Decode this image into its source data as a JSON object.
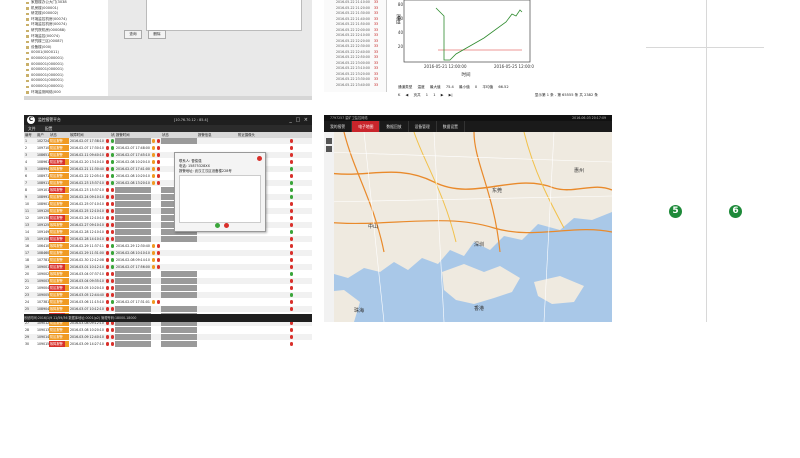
{
  "device_tree": {
    "items": [
      "家庭楼办公大门(3038",
      "机房楼(000001)",
      "研发楼(000002)",
      "环境监控机房(00074)",
      "环境监控机房(00074)",
      "研究院机房(000088)",
      "环境监控(00074)",
      "研究楼三区(00087)",
      "设备楼(000)",
      "00001(000011)",
      "0000001(000001)",
      "0000001(000001)",
      "0000001(000001)",
      "0000001(000001)",
      "0000001(000001)",
      "0000001(000001)",
      "环境监测网络(000"
    ],
    "buttons": [
      "查询",
      "删除"
    ]
  },
  "history_table": {
    "rows": [
      {
        "n": "",
        "t": "2016-05-22 21:10:00",
        "v": "33"
      },
      {
        "n": "",
        "t": "2016-05-22 21:20:00",
        "v": "33"
      },
      {
        "n": "",
        "t": "2016-05-22 21:30:00",
        "v": "33"
      },
      {
        "n": "",
        "t": "2016-05-22 21:40:00",
        "v": "33"
      },
      {
        "n": "",
        "t": "2016-05-22 21:50:00",
        "v": "33"
      },
      {
        "n": "",
        "t": "2016-05-22 22:00:00",
        "v": "33"
      },
      {
        "n": "",
        "t": "2016-05-22 22:10:00",
        "v": "33"
      },
      {
        "n": "",
        "t": "2016-05-22 22:20:00",
        "v": "33"
      },
      {
        "n": "",
        "t": "2016-05-22 22:30:00",
        "v": "33"
      },
      {
        "n": "",
        "t": "2016-05-22 22:40:00",
        "v": "33"
      },
      {
        "n": "",
        "t": "2016-05-22 22:50:00",
        "v": "33"
      },
      {
        "n": "",
        "t": "2016-05-22 23:00:00",
        "v": "33"
      },
      {
        "n": "",
        "t": "2016-05-22 23:10:00",
        "v": "33"
      },
      {
        "n": "",
        "t": "2016-05-22 23:20:00",
        "v": "33"
      },
      {
        "n": "",
        "t": "2016-05-22 23:30:00",
        "v": "33"
      },
      {
        "n": "",
        "t": "2016-05-22 23:40:00",
        "v": "33"
      }
    ]
  },
  "history_chart": {
    "ylabel": "温度",
    "xlabel": "时间",
    "ticks_x": [
      "2016-05-21 12:00:00",
      "2016-05-25 12:00:00"
    ],
    "ticks_y": [
      "80",
      "60",
      "40",
      "20"
    ],
    "line_color": "#2e8b2e",
    "limit_color": "#d9302b"
  },
  "history_stats": {
    "type_label": "通道类型",
    "type_value": "温度",
    "max_label": "最大值",
    "max_value": "75.4",
    "min_label": "最小值",
    "min_value": "0",
    "avg_label": "平均值",
    "avg_value": "66.52"
  },
  "history_pager": {
    "first": "K",
    "prev": "◀",
    "page_label": "页共",
    "page_current": "1",
    "page_total": "1",
    "next": "▶",
    "last": "▶|",
    "summary": "显示第 1 条 - 第 65555 条 共 2382 条"
  },
  "alarm_platform": {
    "title": "监控报警平台",
    "header_info": "[10.76.70.12 : 85.4]",
    "window_buttons": "_ □ ×",
    "menu": [
      "文件",
      "配置"
    ],
    "columns": [
      "编号",
      "用户",
      "状态",
      "",
      "故障时间",
      "",
      "状态",
      "报警时间",
      "",
      "",
      "状态",
      "报警信息",
      "附近摄像头",
      ""
    ],
    "rows": [
      {
        "id": "1",
        "user": "1027242",
        "state": "防区报警",
        "st": "orange",
        "time": "2016-02-07 17:38:10",
        "a": "red",
        "b": "green",
        "t2": "",
        "c": "red",
        "d": "red"
      },
      {
        "id": "2",
        "user": "1097100",
        "state": "防区报警",
        "st": "orange",
        "time": "2016-02-07 17:30:10",
        "a": "red",
        "b": "green",
        "t2": "2016-02-07 17:48:00",
        "c": "red",
        "d": "red"
      },
      {
        "id": "3",
        "user": "108651",
        "state": "防区报警",
        "st": "orange",
        "time": "2016-02-11 09:40:10",
        "a": "red",
        "b": "green",
        "t2": "2016-02-07 17:45:10",
        "c": "red",
        "d": "red"
      },
      {
        "id": "4",
        "user": "108961",
        "state": "防区报警",
        "st": "red",
        "time": "2016-02-20 13:10:10",
        "a": "red",
        "b": "green",
        "t2": "2016-02-08 10:20:10",
        "c": "red",
        "d": "red"
      },
      {
        "id": "5",
        "user": "1089944",
        "state": "故障报警",
        "st": "orange",
        "time": "2016-02-21 11:30:40",
        "a": "red",
        "b": "green",
        "t2": "2016-02-07 17:41:00",
        "c": "red",
        "d": "green"
      },
      {
        "id": "6",
        "user": "108971",
        "state": "防区报警",
        "st": "orange",
        "time": "2016-02-22 12:05:10",
        "a": "red",
        "b": "green",
        "t2": "2016-02-08 10:20:10",
        "c": "red",
        "d": "red"
      },
      {
        "id": "7",
        "user": "108911",
        "state": "防区报警",
        "st": "orange",
        "time": "2016-02-23 15:37:10",
        "a": "red",
        "b": "green",
        "t2": "2016-02-08 13:20:10",
        "c": "red",
        "d": "green"
      },
      {
        "id": "8",
        "user": "109101",
        "state": "故障报警",
        "st": "red",
        "time": "2016-02-23 15:37:10",
        "a": "red",
        "b": "red",
        "t2": "",
        "c": "",
        "d": "green"
      },
      {
        "id": "9",
        "user": "108991",
        "state": "防区报警",
        "st": "orange",
        "time": "2016-02-24 09:10:10",
        "a": "red",
        "b": "red",
        "t2": "",
        "c": "",
        "d": "green"
      },
      {
        "id": "10",
        "user": "108901",
        "state": "防区报警",
        "st": "orange",
        "time": "2016-02-25 07:10:10",
        "a": "red",
        "b": "red",
        "t2": "",
        "c": "",
        "d": "red"
      },
      {
        "id": "11",
        "user": "109120",
        "state": "防区报警",
        "st": "orange",
        "time": "2016-02-25 12:10:10",
        "a": "red",
        "b": "red",
        "t2": "",
        "c": "",
        "d": "red"
      },
      {
        "id": "12",
        "user": "109130",
        "state": "防区报警",
        "st": "red",
        "time": "2016-02-26 12:10:10",
        "a": "red",
        "b": "red",
        "t2": "",
        "c": "",
        "d": "red"
      },
      {
        "id": "13",
        "user": "109125",
        "state": "故障报警",
        "st": "orange",
        "time": "2016-02-27 09:10:10",
        "a": "red",
        "b": "red",
        "t2": "",
        "c": "",
        "d": "red"
      },
      {
        "id": "14",
        "user": "109149",
        "state": "防区报警",
        "st": "orange",
        "time": "2016-02-28 12:10:10",
        "a": "red",
        "b": "red",
        "t2": "",
        "c": "",
        "d": "green"
      },
      {
        "id": "15",
        "user": "109150",
        "state": "防区报警",
        "st": "red",
        "time": "2016-02-28 14:10:10",
        "a": "red",
        "b": "red",
        "t2": "",
        "c": "",
        "d": "red"
      },
      {
        "id": "16",
        "user": "106410",
        "state": "故障报警",
        "st": "orange",
        "time": "2016-02-29 11:37:11",
        "a": "red",
        "b": "green",
        "t2": "2016-02-29 12:30:40",
        "c": "red",
        "d": "red"
      },
      {
        "id": "17",
        "user": "108460",
        "state": "防区报警",
        "st": "orange",
        "time": "2016-02-29 11:31:00",
        "a": "red",
        "b": "green",
        "t2": "2016-02-08 10:10:10",
        "c": "red",
        "d": "red"
      },
      {
        "id": "18",
        "user": "107781",
        "state": "防区报警",
        "st": "orange",
        "time": "2016-02-30 12:12:08",
        "a": "red",
        "b": "green",
        "t2": "2016-02-08 09:14:10",
        "c": "red",
        "d": "red"
      },
      {
        "id": "19",
        "user": "109001",
        "state": "防区报警",
        "st": "red",
        "time": "2016-03-01 10:12:10",
        "a": "red",
        "b": "green",
        "t2": "2016-02-07 17:56:00",
        "c": "red",
        "d": "red"
      },
      {
        "id": "20",
        "user": "109002",
        "state": "故障报警",
        "st": "orange",
        "time": "2016-03-04 07:37:10",
        "a": "red",
        "b": "red",
        "t2": "",
        "c": "",
        "d": "green"
      },
      {
        "id": "21",
        "user": "109003",
        "state": "防区报警",
        "st": "orange",
        "time": "2016-03-04 09:35:10",
        "a": "red",
        "b": "red",
        "t2": "",
        "c": "",
        "d": "red"
      },
      {
        "id": "22",
        "user": "109004",
        "state": "防区报警",
        "st": "red",
        "time": "2016-03-05 10:20:10",
        "a": "red",
        "b": "red",
        "t2": "",
        "c": "",
        "d": "red"
      },
      {
        "id": "23",
        "user": "109005",
        "state": "防区报警",
        "st": "orange",
        "time": "2016-03-05 12:44:40",
        "a": "red",
        "b": "red",
        "t2": "",
        "c": "",
        "d": "green"
      },
      {
        "id": "24",
        "user": "107381",
        "state": "防区报警",
        "st": "orange",
        "time": "2016-03-06 11:15:10",
        "a": "red",
        "b": "green",
        "t2": "2016-02-07 17:31:01",
        "c": "red",
        "d": "red"
      },
      {
        "id": "25",
        "user": "108904",
        "state": "故障报警",
        "st": "orange",
        "time": "2016-03-07 10:12:10",
        "a": "red",
        "b": "red",
        "t2": "",
        "c": "",
        "d": "red"
      },
      {
        "id": "26",
        "user": "109011",
        "state": "防区报警",
        "st": "red",
        "time": "2016-03-07 14:27:10",
        "a": "red",
        "b": "red",
        "t2": "",
        "c": "",
        "d": "green"
      },
      {
        "id": "27",
        "user": "109012",
        "state": "防区报警",
        "st": "orange",
        "time": "2016-03-08 09:12:10",
        "a": "red",
        "b": "red",
        "t2": "",
        "c": "",
        "d": "red"
      },
      {
        "id": "28",
        "user": "109013",
        "state": "防区报警",
        "st": "orange",
        "time": "2016-03-08 10:20:10",
        "a": "red",
        "b": "red",
        "t2": "",
        "c": "",
        "d": "red"
      },
      {
        "id": "29",
        "user": "109014",
        "state": "防区报警",
        "st": "orange",
        "time": "2016-03-09 12:40:10",
        "a": "red",
        "b": "red",
        "t2": "",
        "c": "",
        "d": "red"
      },
      {
        "id": "30",
        "user": "109015",
        "state": "故障报警",
        "st": "red",
        "time": "2016-03-09 14:27:10",
        "a": "red",
        "b": "red",
        "t2": "",
        "c": "",
        "d": "red"
      }
    ],
    "statusbar": "系统时间:2016/1/9 11/59/36  数据库地址:0001(p2) 管理号码:18000-18000",
    "popup": {
      "line1_label": "联系人:",
      "line1_value": "曹俊强",
      "line2_label": "电话:",
      "line2_value": "15875328XX",
      "line3_label": "报警地址:",
      "line3_value": "武汉江汉区设备楼228号"
    },
    "colors": {
      "orange": "#f09a22",
      "red": "#d9302b",
      "green": "#3aa53a",
      "titlebar": "#1f1f1f"
    }
  },
  "map_app": {
    "topbar_left": "7797257  星矿卫监控网络",
    "topbar_right": "2016-06-03 20:17:09",
    "tabs": [
      "我的报警",
      "电子地图",
      "数据回放",
      "设备管理",
      "数据设置"
    ],
    "active_tab": 1,
    "labels": [
      "深圳",
      "香港",
      "珠海",
      "中山",
      "东莞",
      "惠州"
    ],
    "colors": {
      "water": "#a9c8e8",
      "land": "#efeae0",
      "road": "#e98a2b",
      "active_tab": "#c9252b"
    }
  },
  "markers": [
    "5",
    "6"
  ]
}
